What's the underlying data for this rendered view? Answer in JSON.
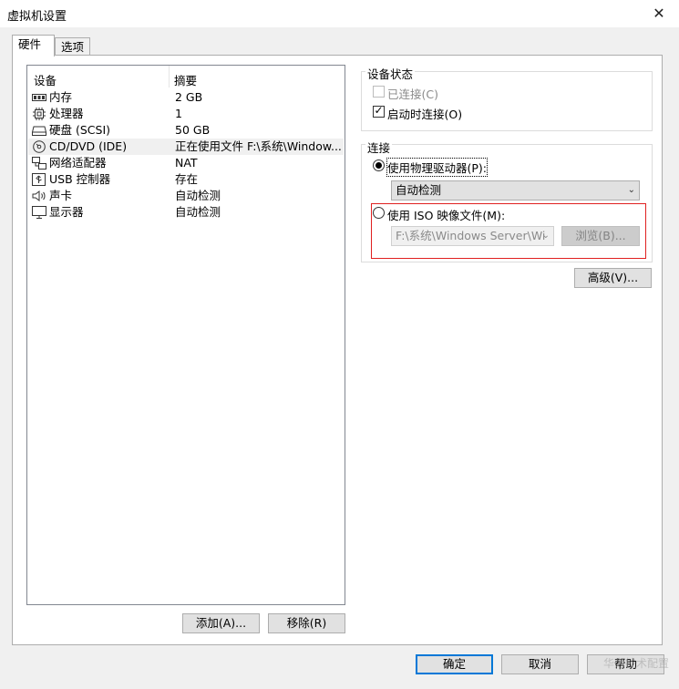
{
  "window": {
    "title": "虚拟机设置",
    "close_symbol": "✕"
  },
  "tabs": [
    {
      "label": "硬件",
      "active": true
    },
    {
      "label": "选项",
      "active": false
    }
  ],
  "device_list": {
    "headers": {
      "device": "设备",
      "summary": "摘要"
    },
    "rows": [
      {
        "icon": "memory-icon",
        "name": "内存",
        "summary": "2 GB"
      },
      {
        "icon": "processor-icon",
        "name": "处理器",
        "summary": "1"
      },
      {
        "icon": "hard-disk-icon",
        "name": "硬盘 (SCSI)",
        "summary": "50 GB"
      },
      {
        "icon": "cd-dvd-icon",
        "name": "CD/DVD (IDE)",
        "summary": "正在使用文件 F:\\系统\\Window...",
        "selected": true
      },
      {
        "icon": "network-adapter-icon",
        "name": "网络适配器",
        "summary": "NAT"
      },
      {
        "icon": "usb-icon",
        "name": "USB 控制器",
        "summary": "存在"
      },
      {
        "icon": "sound-card-icon",
        "name": "声卡",
        "summary": "自动检测"
      },
      {
        "icon": "display-icon",
        "name": "显示器",
        "summary": "自动检测"
      }
    ]
  },
  "device_buttons": {
    "add": "添加(A)...",
    "remove": "移除(R)"
  },
  "device_status": {
    "label": "设备状态",
    "connected": {
      "label": "已连接(C)",
      "checked": false,
      "enabled": false
    },
    "connect_at_power_on": {
      "label": "启动时连接(O)",
      "checked": true,
      "enabled": true
    }
  },
  "connection": {
    "label": "连接",
    "physical_drive": {
      "label": "使用物理驱动器(P):",
      "selected": true
    },
    "physical_drive_select": "自动检测",
    "iso_image": {
      "label": "使用 ISO 映像文件(M):",
      "selected": false
    },
    "iso_path": "F:\\系统\\Windows Server\\Wi",
    "browse": "浏览(B)..."
  },
  "advanced_button": "高级(V)...",
  "footer": {
    "ok": "确定",
    "cancel": "取消",
    "help": "帮助"
  },
  "watermark": "华为技术配置",
  "colors": {
    "accent": "#0078d7",
    "highlight_border": "#e02020",
    "selection": "#f0f0f0"
  }
}
